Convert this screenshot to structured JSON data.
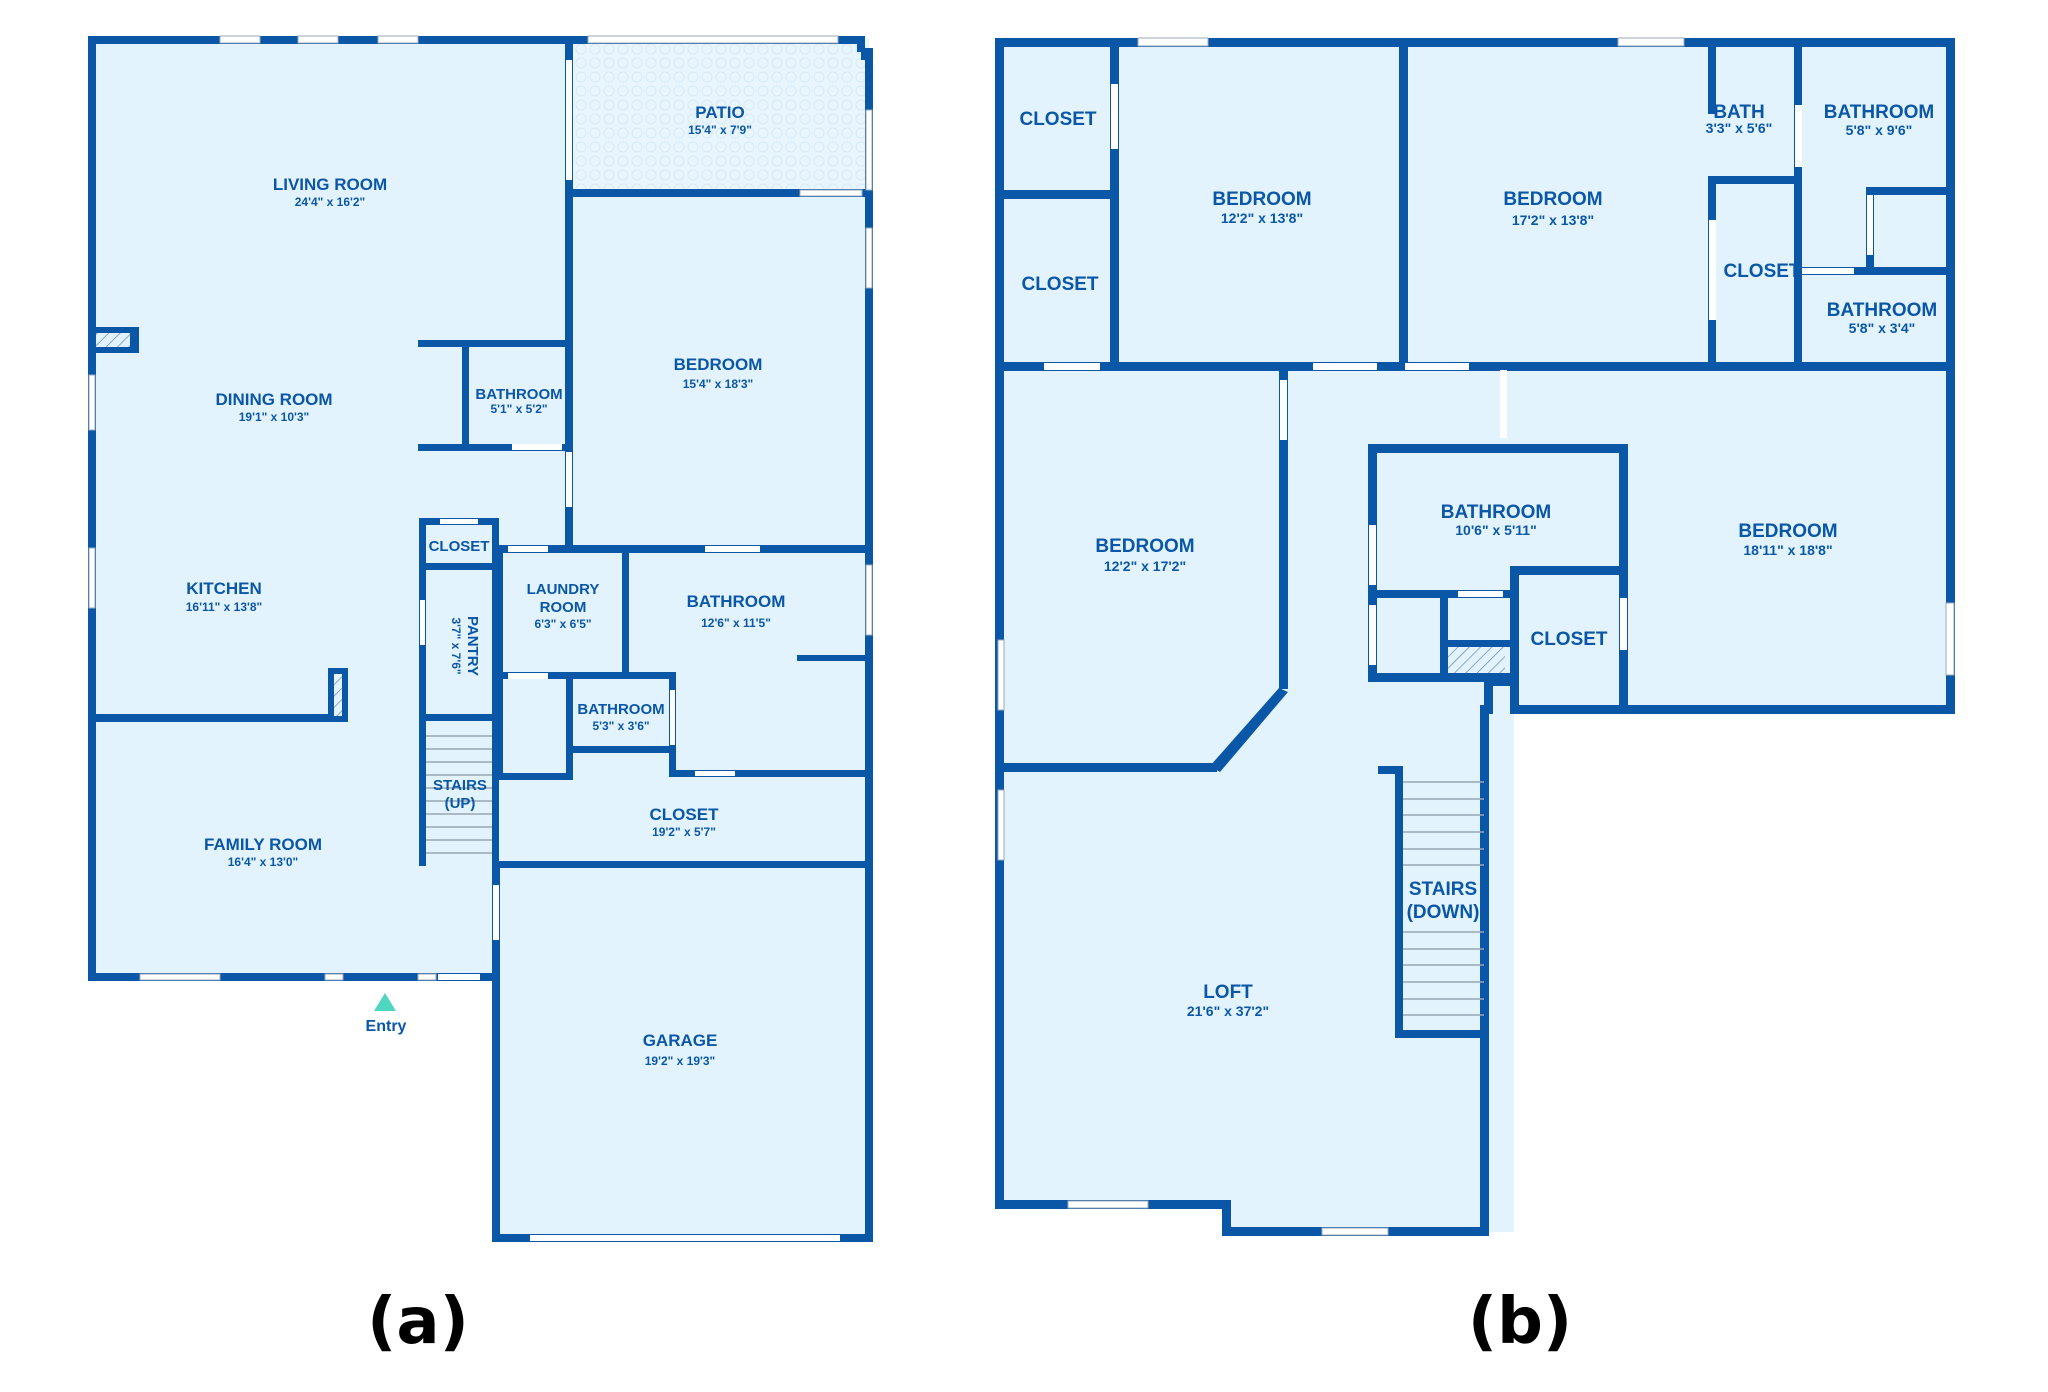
{
  "colors": {
    "wall": "#0a57a8",
    "floor": "#e3f3fd",
    "label": "#0a57a8",
    "entry_marker": "#4fd6c0",
    "caption": "#000000"
  },
  "plan_a": {
    "caption": "(a)",
    "entry_label": "Entry",
    "rooms": {
      "living_room": {
        "name": "LIVING ROOM",
        "dims": "24'4\" x 16'2\""
      },
      "patio": {
        "name": "PATIO",
        "dims": "15'4\" x 7'9\""
      },
      "dining_room": {
        "name": "DINING ROOM",
        "dims": "19'1\" x 10'3\""
      },
      "bathroom_1": {
        "name": "BATHROOM",
        "dims": "5'1\" x 5'2\""
      },
      "bedroom": {
        "name": "BEDROOM",
        "dims": "15'4\" x 18'3\""
      },
      "kitchen": {
        "name": "KITCHEN",
        "dims": "16'11\" x 13'8\""
      },
      "closet_small": {
        "name": "CLOSET"
      },
      "pantry": {
        "name": "PANTRY",
        "dims": "3'7\" x 7'6\""
      },
      "laundry_room": {
        "name_line1": "LAUNDRY",
        "name_line2": "ROOM",
        "dims": "6'3\" x 6'5\""
      },
      "bathroom_2": {
        "name": "BATHROOM",
        "dims": "12'6\" x 11'5\""
      },
      "bathroom_3": {
        "name": "BATHROOM",
        "dims": "5'3\" x 3'6\""
      },
      "stairs": {
        "name_line1": "STAIRS",
        "name_line2": "(UP)"
      },
      "closet_large": {
        "name": "CLOSET",
        "dims": "19'2\" x 5'7\""
      },
      "family_room": {
        "name": "FAMILY ROOM",
        "dims": "16'4\" x 13'0\""
      },
      "garage": {
        "name": "GARAGE",
        "dims": "19'2\" x 19'3\""
      }
    }
  },
  "plan_b": {
    "caption": "(b)",
    "rooms": {
      "closet_1": {
        "name": "CLOSET"
      },
      "closet_2": {
        "name": "CLOSET"
      },
      "bedroom_1": {
        "name": "BEDROOM",
        "dims": "12'2\" x 13'8\""
      },
      "bedroom_2": {
        "name": "BEDROOM",
        "dims": "17'2\" x 13'8\""
      },
      "bath": {
        "name": "BATH",
        "dims": "3'3\" x 5'6\""
      },
      "bathroom_1": {
        "name": "BATHROOM",
        "dims": "5'8\" x 9'6\""
      },
      "closet_3": {
        "name": "CLOSET"
      },
      "bathroom_2": {
        "name": "BATHROOM",
        "dims": "5'8\" x 3'4\""
      },
      "bedroom_3": {
        "name": "BEDROOM",
        "dims": "12'2\" x 17'2\""
      },
      "bathroom_3": {
        "name": "BATHROOM",
        "dims": "10'6\" x 5'11\""
      },
      "closet_4": {
        "name": "CLOSET"
      },
      "bedroom_4": {
        "name": "BEDROOM",
        "dims": "18'11\" x 18'8\""
      },
      "stairs": {
        "name_line1": "STAIRS",
        "name_line2": "(DOWN)"
      },
      "loft": {
        "name": "LOFT",
        "dims": "21'6\" x 37'2\""
      }
    }
  }
}
